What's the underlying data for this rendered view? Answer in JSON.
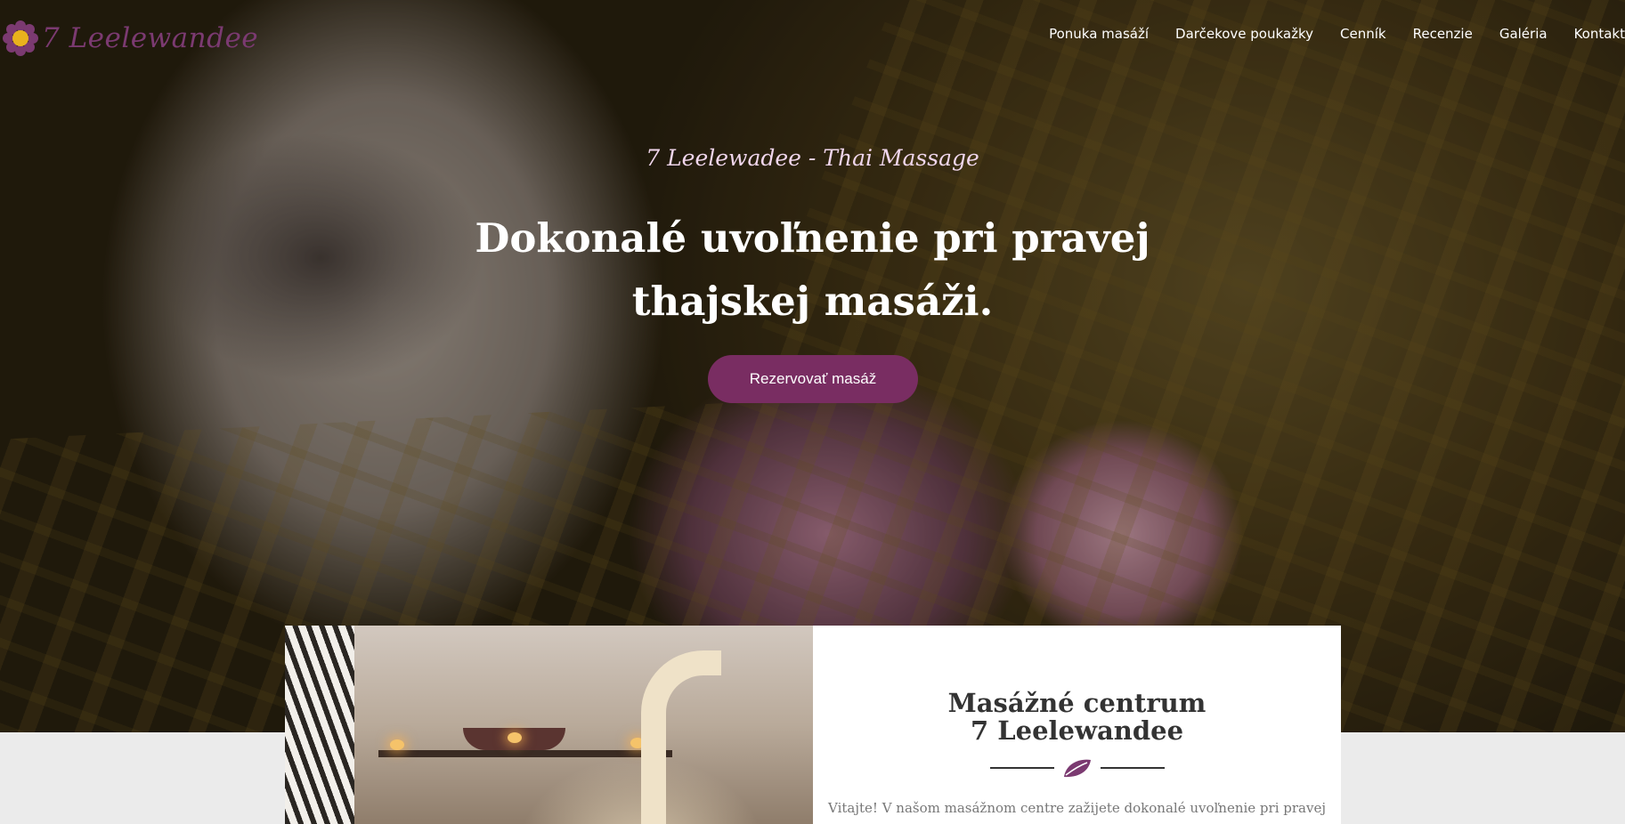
{
  "brand": {
    "name": "7 Leelewandee",
    "color": "#7b3a71",
    "logo_icon": "flower-icon"
  },
  "nav": {
    "items": [
      {
        "label": "Ponuka masáží"
      },
      {
        "label": "Darčekove poukažky"
      },
      {
        "label": "Cenník"
      },
      {
        "label": "Recenzie"
      },
      {
        "label": "Galéria"
      },
      {
        "label": "Kontakt"
      }
    ]
  },
  "hero": {
    "subtitle": "7 Leelewadee - Thai Massage",
    "title": "Dokonalé uvoľnenie pri pravej thajskej masáži.",
    "cta_label": "Rezervovať masáž",
    "cta_color": "#792d62"
  },
  "intro_card": {
    "title_line1": "Masážné centrum",
    "title_line2": "7 Leelewandee",
    "divider_icon": "leaf-icon",
    "text": "Vitajte! V našom masážnom centre zažijete dokonalé uvoľnenie pri pravej"
  }
}
